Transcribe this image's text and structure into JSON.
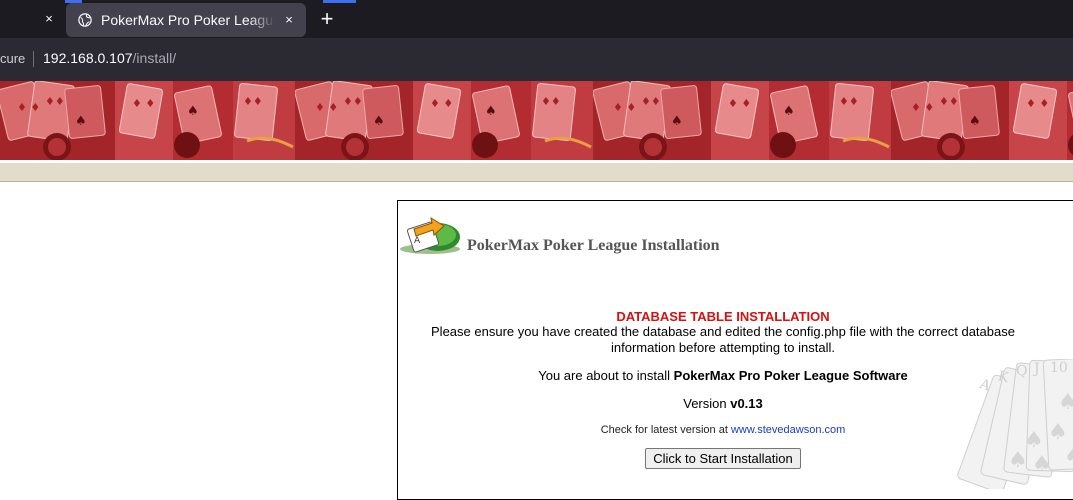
{
  "browser": {
    "prev_tab_close": "×",
    "active_tab_title": "PokerMax Pro Poker League Installation",
    "active_tab_close": "×",
    "new_tab": "+",
    "security_label": "cure",
    "url_host": "192.168.0.107",
    "url_path": "/install/"
  },
  "install": {
    "title": "PokerMax Poker League Installation",
    "heading": "DATABASE TABLE INSTALLATION",
    "ensure_text": "Please ensure you have created the database and edited the config.php file with the correct database information before attempting to install.",
    "about_prefix": "You are about to install ",
    "product_name": "PokerMax Pro Poker League Software",
    "version_prefix": "Version ",
    "version": "v0.13",
    "check_prefix": "Check for latest version at ",
    "check_link": "www.stevedawson.com",
    "start_button": "Click to Start Installation"
  },
  "colors": {
    "heading_red": "#d81010",
    "banner_red": "#b3262c",
    "link_blue": "#1a3cbf"
  },
  "icons": {
    "tab_favicon": "globe-icon",
    "logo": "install-arrow-logo",
    "decoration": "playing-cards-watermark"
  }
}
